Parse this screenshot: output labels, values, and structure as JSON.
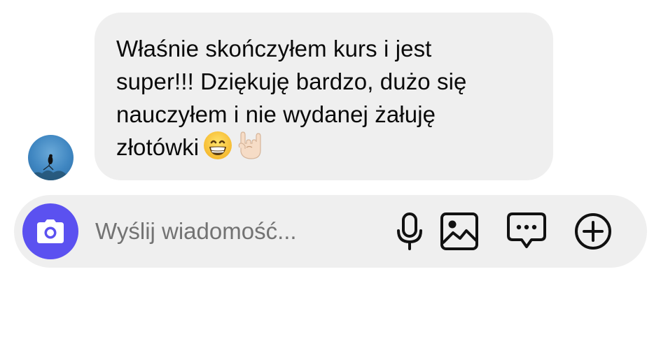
{
  "message": {
    "text": "Właśnie skończyłem kurs i jest\nsuper!!! Dziękuję bardzo, dużo się\nnauczyłem i nie wydanej żałuję\nzłotówki",
    "emojis": [
      "grinning-face-with-smiling-eyes",
      "sign-of-the-horns-light-skin-tone"
    ]
  },
  "composer": {
    "placeholder": "Wyślij wiadomość...",
    "icons": {
      "camera": "camera-icon",
      "microphone": "microphone-icon",
      "image": "image-icon",
      "sticker": "chat-bubble-icon",
      "more": "plus-circle-icon"
    }
  },
  "colors": {
    "accent": "#5b51f0",
    "bubble": "#efefef",
    "composer": "#efefef"
  }
}
